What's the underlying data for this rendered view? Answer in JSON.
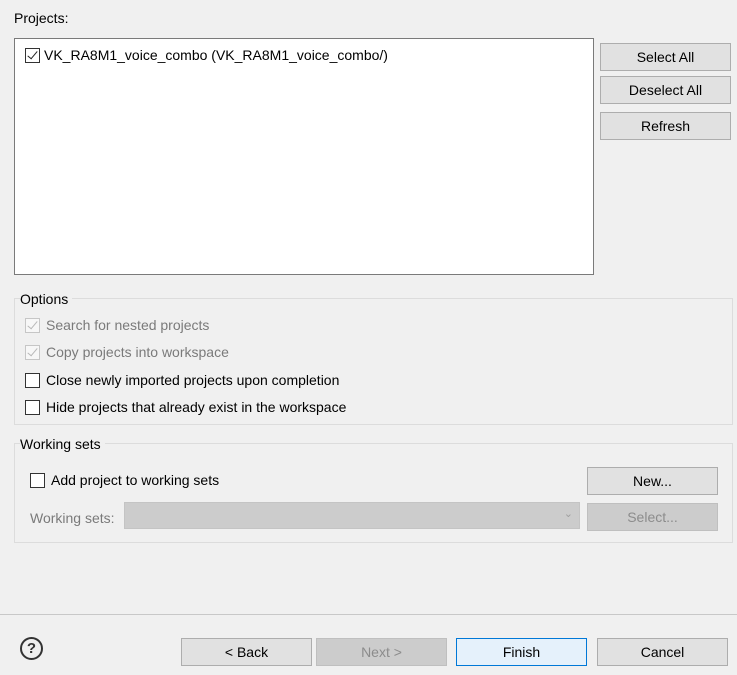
{
  "projects": {
    "label": "Projects:",
    "items": [
      {
        "label": "VK_RA8M1_voice_combo (VK_RA8M1_voice_combo/)",
        "checked": true
      }
    ],
    "select_all": "Select All",
    "deselect_all": "Deselect All",
    "refresh": "Refresh"
  },
  "options": {
    "legend": "Options",
    "search_nested": "Search for nested projects",
    "copy_into_workspace": "Copy projects into workspace",
    "close_imported": "Close newly imported projects upon completion",
    "hide_existing": "Hide projects that already exist in the workspace"
  },
  "working_sets": {
    "legend": "Working sets",
    "add_to_working_sets": "Add project to working sets",
    "new_button": "New...",
    "working_sets_label": "Working sets:",
    "select_button": "Select..."
  },
  "footer": {
    "help": "?",
    "back": "< Back",
    "next": "Next >",
    "finish": "Finish",
    "cancel": "Cancel"
  },
  "icons": {
    "help": "help-icon",
    "dropdown": "chevron-down-icon",
    "check": "check-icon"
  },
  "colors": {
    "window_bg": "#f0f0f0",
    "default_button_border": "#0078d7",
    "disabled_text": "#7a7a7a"
  }
}
